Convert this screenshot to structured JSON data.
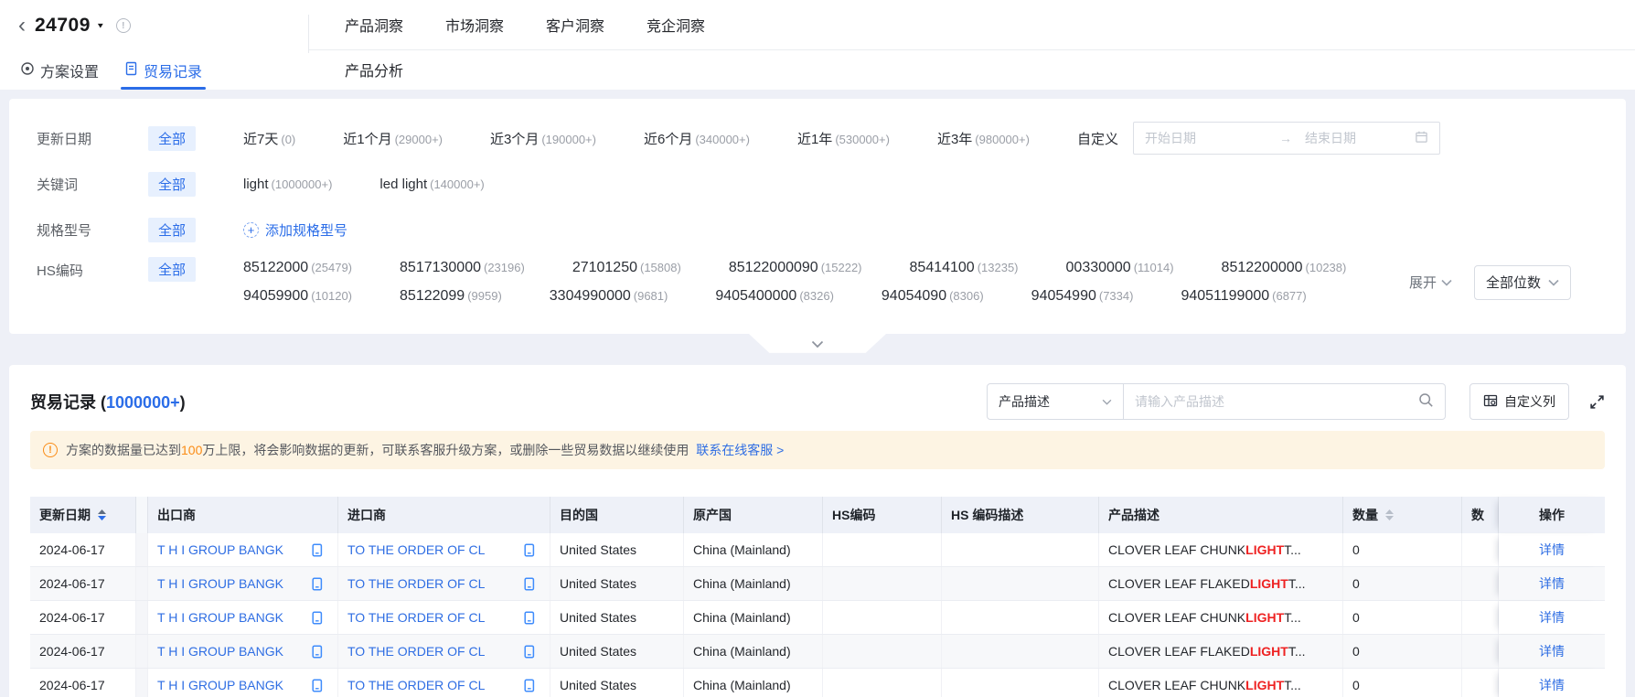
{
  "header": {
    "back_glyph": "‹",
    "plan_id": "24709",
    "dropdown_glyph": "▼",
    "info_glyph": "!",
    "left_tabs": [
      {
        "label": "方案设置",
        "icon": "settings-icon",
        "active": false
      },
      {
        "label": "贸易记录",
        "icon": "document-icon",
        "active": true
      }
    ],
    "main_tabs": [
      "产品洞察",
      "市场洞察",
      "客户洞察",
      "竞企洞察"
    ],
    "sub_tab": "产品分析"
  },
  "filters": {
    "date": {
      "label": "更新日期",
      "all_label": "全部",
      "options": [
        {
          "text": "近7天",
          "count": "(0)"
        },
        {
          "text": "近1个月",
          "count": "(29000+)"
        },
        {
          "text": "近3个月",
          "count": "(190000+)"
        },
        {
          "text": "近6个月",
          "count": "(340000+)"
        },
        {
          "text": "近1年",
          "count": "(530000+)"
        },
        {
          "text": "近3年",
          "count": "(980000+)"
        }
      ],
      "custom_label": "自定义",
      "start_placeholder": "开始日期",
      "arrow_glyph": "→",
      "end_placeholder": "结束日期"
    },
    "keyword": {
      "label": "关键词",
      "all_label": "全部",
      "options": [
        {
          "text": "light",
          "count": "(1000000+)"
        },
        {
          "text": "led light",
          "count": "(140000+)"
        }
      ]
    },
    "spec": {
      "label": "规格型号",
      "all_label": "全部",
      "plus_glyph": "+",
      "add_label": "添加规格型号"
    },
    "hs": {
      "label": "HS编码",
      "all_label": "全部",
      "line1": [
        {
          "text": "85122000",
          "count": "(25479)"
        },
        {
          "text": "8517130000",
          "count": "(23196)"
        },
        {
          "text": "27101250",
          "count": "(15808)"
        },
        {
          "text": "85122000090",
          "count": "(15222)"
        },
        {
          "text": "85414100",
          "count": "(13235)"
        },
        {
          "text": "00330000",
          "count": "(11014)"
        },
        {
          "text": "8512200000",
          "count": "(10238)"
        }
      ],
      "line2": [
        {
          "text": "94059900",
          "count": "(10120)"
        },
        {
          "text": "85122099",
          "count": "(9959)"
        },
        {
          "text": "3304990000",
          "count": "(9681)"
        },
        {
          "text": "9405400000",
          "count": "(8326)"
        },
        {
          "text": "94054090",
          "count": "(8306)"
        },
        {
          "text": "94054990",
          "count": "(7334)"
        },
        {
          "text": "94051199000",
          "count": "(6877)"
        }
      ],
      "expand_label": "展开",
      "digits_label": "全部位数"
    }
  },
  "records": {
    "title": "贸易记录",
    "count_open": "(",
    "count": "1000000+",
    "count_close": ")",
    "field_select": "产品描述",
    "search_placeholder": "请输入产品描述",
    "custom_columns_label": "自定义列",
    "warning": {
      "prefix": "方案的数据量已达到",
      "highlight": "100",
      "suffix": "万上限，将会影响数据的更新，可联系客服升级方案，或删除一些贸易数据以继续使用",
      "link": "联系在线客服 >"
    }
  },
  "table": {
    "columns": [
      {
        "label": "更新日期",
        "sort": "desc-active"
      },
      {
        "label": ""
      },
      {
        "label": "出口商"
      },
      {
        "label": "进口商"
      },
      {
        "label": "目的国"
      },
      {
        "label": "原产国"
      },
      {
        "label": "HS编码"
      },
      {
        "label": "HS 编码描述"
      },
      {
        "label": "产品描述"
      },
      {
        "label": "数量",
        "sort": "none"
      },
      {
        "label": "数"
      },
      {
        "label": "操作"
      }
    ],
    "rows": [
      {
        "date": "2024-06-17",
        "exporter": "T H I GROUP BANGK",
        "importer": "TO THE ORDER OF CL",
        "destination": "United States",
        "origin": "China (Mainland)",
        "hs_code": "",
        "hs_desc": "",
        "product_prefix": "CLOVER LEAF CHUNK ",
        "product_highlight": "LIGHT",
        "product_suffix": " T...",
        "quantity": "0",
        "action": "详情"
      },
      {
        "date": "2024-06-17",
        "exporter": "T H I GROUP BANGK",
        "importer": "TO THE ORDER OF CL",
        "destination": "United States",
        "origin": "China (Mainland)",
        "hs_code": "",
        "hs_desc": "",
        "product_prefix": "CLOVER LEAF FLAKED ",
        "product_highlight": "LIGHT",
        "product_suffix": " T...",
        "quantity": "0",
        "action": "详情"
      },
      {
        "date": "2024-06-17",
        "exporter": "T H I GROUP BANGK",
        "importer": "TO THE ORDER OF CL",
        "destination": "United States",
        "origin": "China (Mainland)",
        "hs_code": "",
        "hs_desc": "",
        "product_prefix": "CLOVER LEAF CHUNK ",
        "product_highlight": "LIGHT",
        "product_suffix": " T...",
        "quantity": "0",
        "action": "详情"
      },
      {
        "date": "2024-06-17",
        "exporter": "T H I GROUP BANGK",
        "importer": "TO THE ORDER OF CL",
        "destination": "United States",
        "origin": "China (Mainland)",
        "hs_code": "",
        "hs_desc": "",
        "product_prefix": "CLOVER LEAF FLAKED ",
        "product_highlight": "LIGHT",
        "product_suffix": " T...",
        "quantity": "0",
        "action": "详情"
      },
      {
        "date": "2024-06-17",
        "exporter": "T H I GROUP BANGK",
        "importer": "TO THE ORDER OF CL",
        "destination": "United States",
        "origin": "China (Mainland)",
        "hs_code": "",
        "hs_desc": "",
        "product_prefix": "CLOVER LEAF CHUNK ",
        "product_highlight": "LIGHT",
        "product_suffix": " T...",
        "quantity": "0",
        "action": "详情"
      }
    ]
  },
  "colors": {
    "accent_blue": "#2b6de8",
    "link_blue": "#2f6ee3",
    "warning_orange": "#fa8c16",
    "highlight_red": "#ee2222",
    "warning_bg": "#fdf4e3",
    "tag_bg": "#e7f0fe",
    "table_header_bg": "#eef1f8",
    "page_bg": "#eef0f7"
  },
  "icons": {
    "back": "chevron-left",
    "plan_dropdown": "caret-down",
    "plan_info": "info-circle",
    "settings": "circled-dot",
    "document": "clipboard",
    "add_spec": "dashed-plus-circle",
    "date_arrow": "arrow-right",
    "calendar": "calendar",
    "search": "magnifier",
    "custom_columns": "table-gear",
    "fullscreen": "expand-corners",
    "collapse": "chevron-down",
    "warning": "exclamation-circle",
    "copy": "copy",
    "sort": "caret-up-down"
  }
}
